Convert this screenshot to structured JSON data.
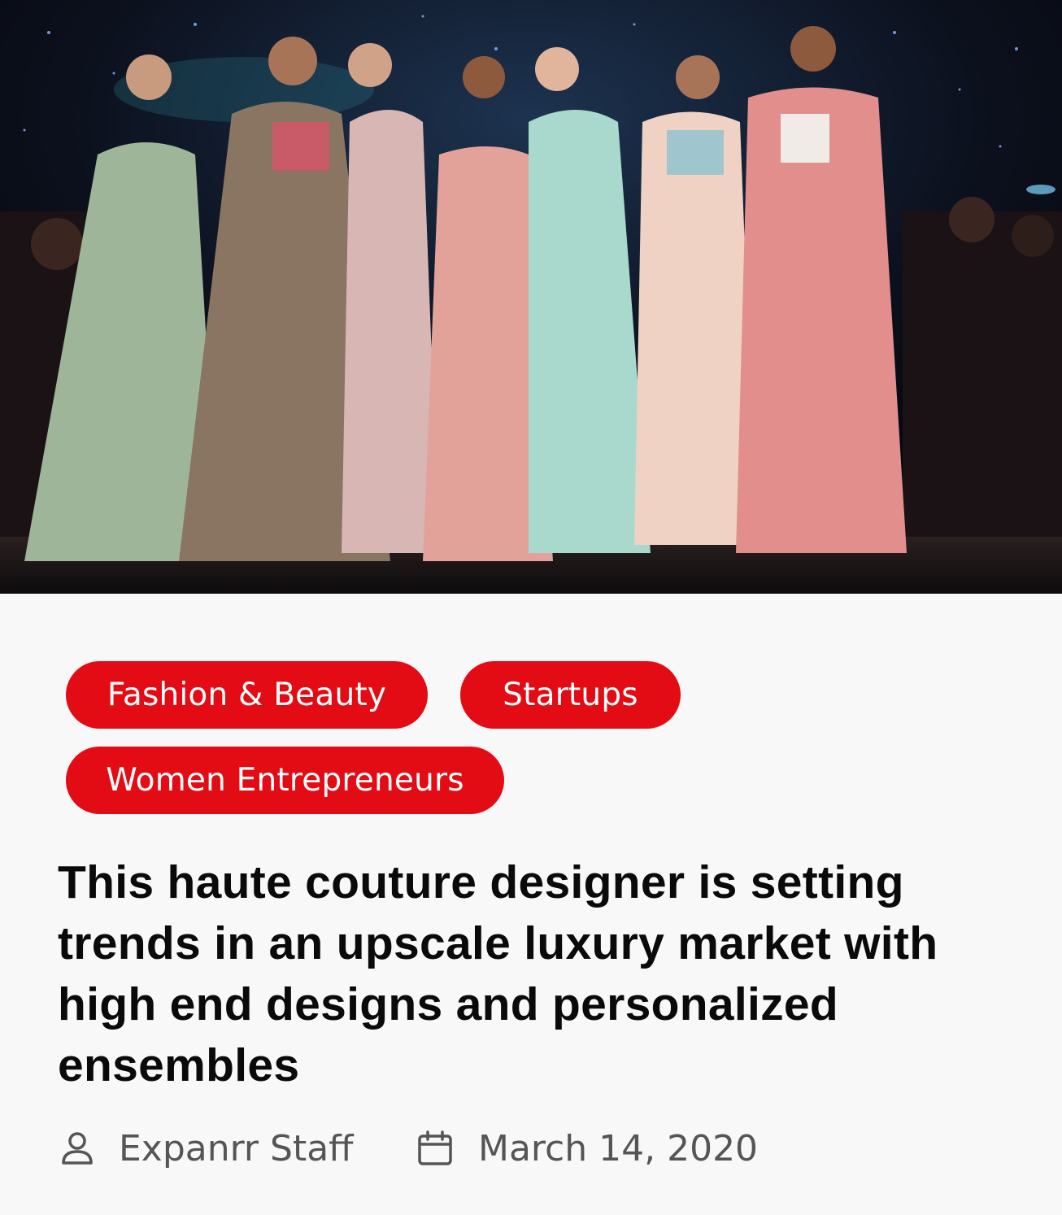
{
  "hero": {
    "image_alt": "Models in pastel ensembles on a fashion show runway"
  },
  "tags": [
    {
      "label": "Fashion & Beauty"
    },
    {
      "label": "Startups"
    },
    {
      "label": "Women Entrepreneurs"
    }
  ],
  "article": {
    "title": "This haute couture designer is setting trends in an upscale luxury market with high end designs and personalized ensembles",
    "author": "Expanrr Staff",
    "date": "March 14, 2020"
  },
  "icons": {
    "author": "person-icon",
    "date": "calendar-icon"
  },
  "colors": {
    "tag_background": "#e30b14",
    "tag_text": "#ffffff",
    "title_text": "#0a0a0a",
    "meta_text": "#555555",
    "page_background": "#f8f8f8"
  }
}
